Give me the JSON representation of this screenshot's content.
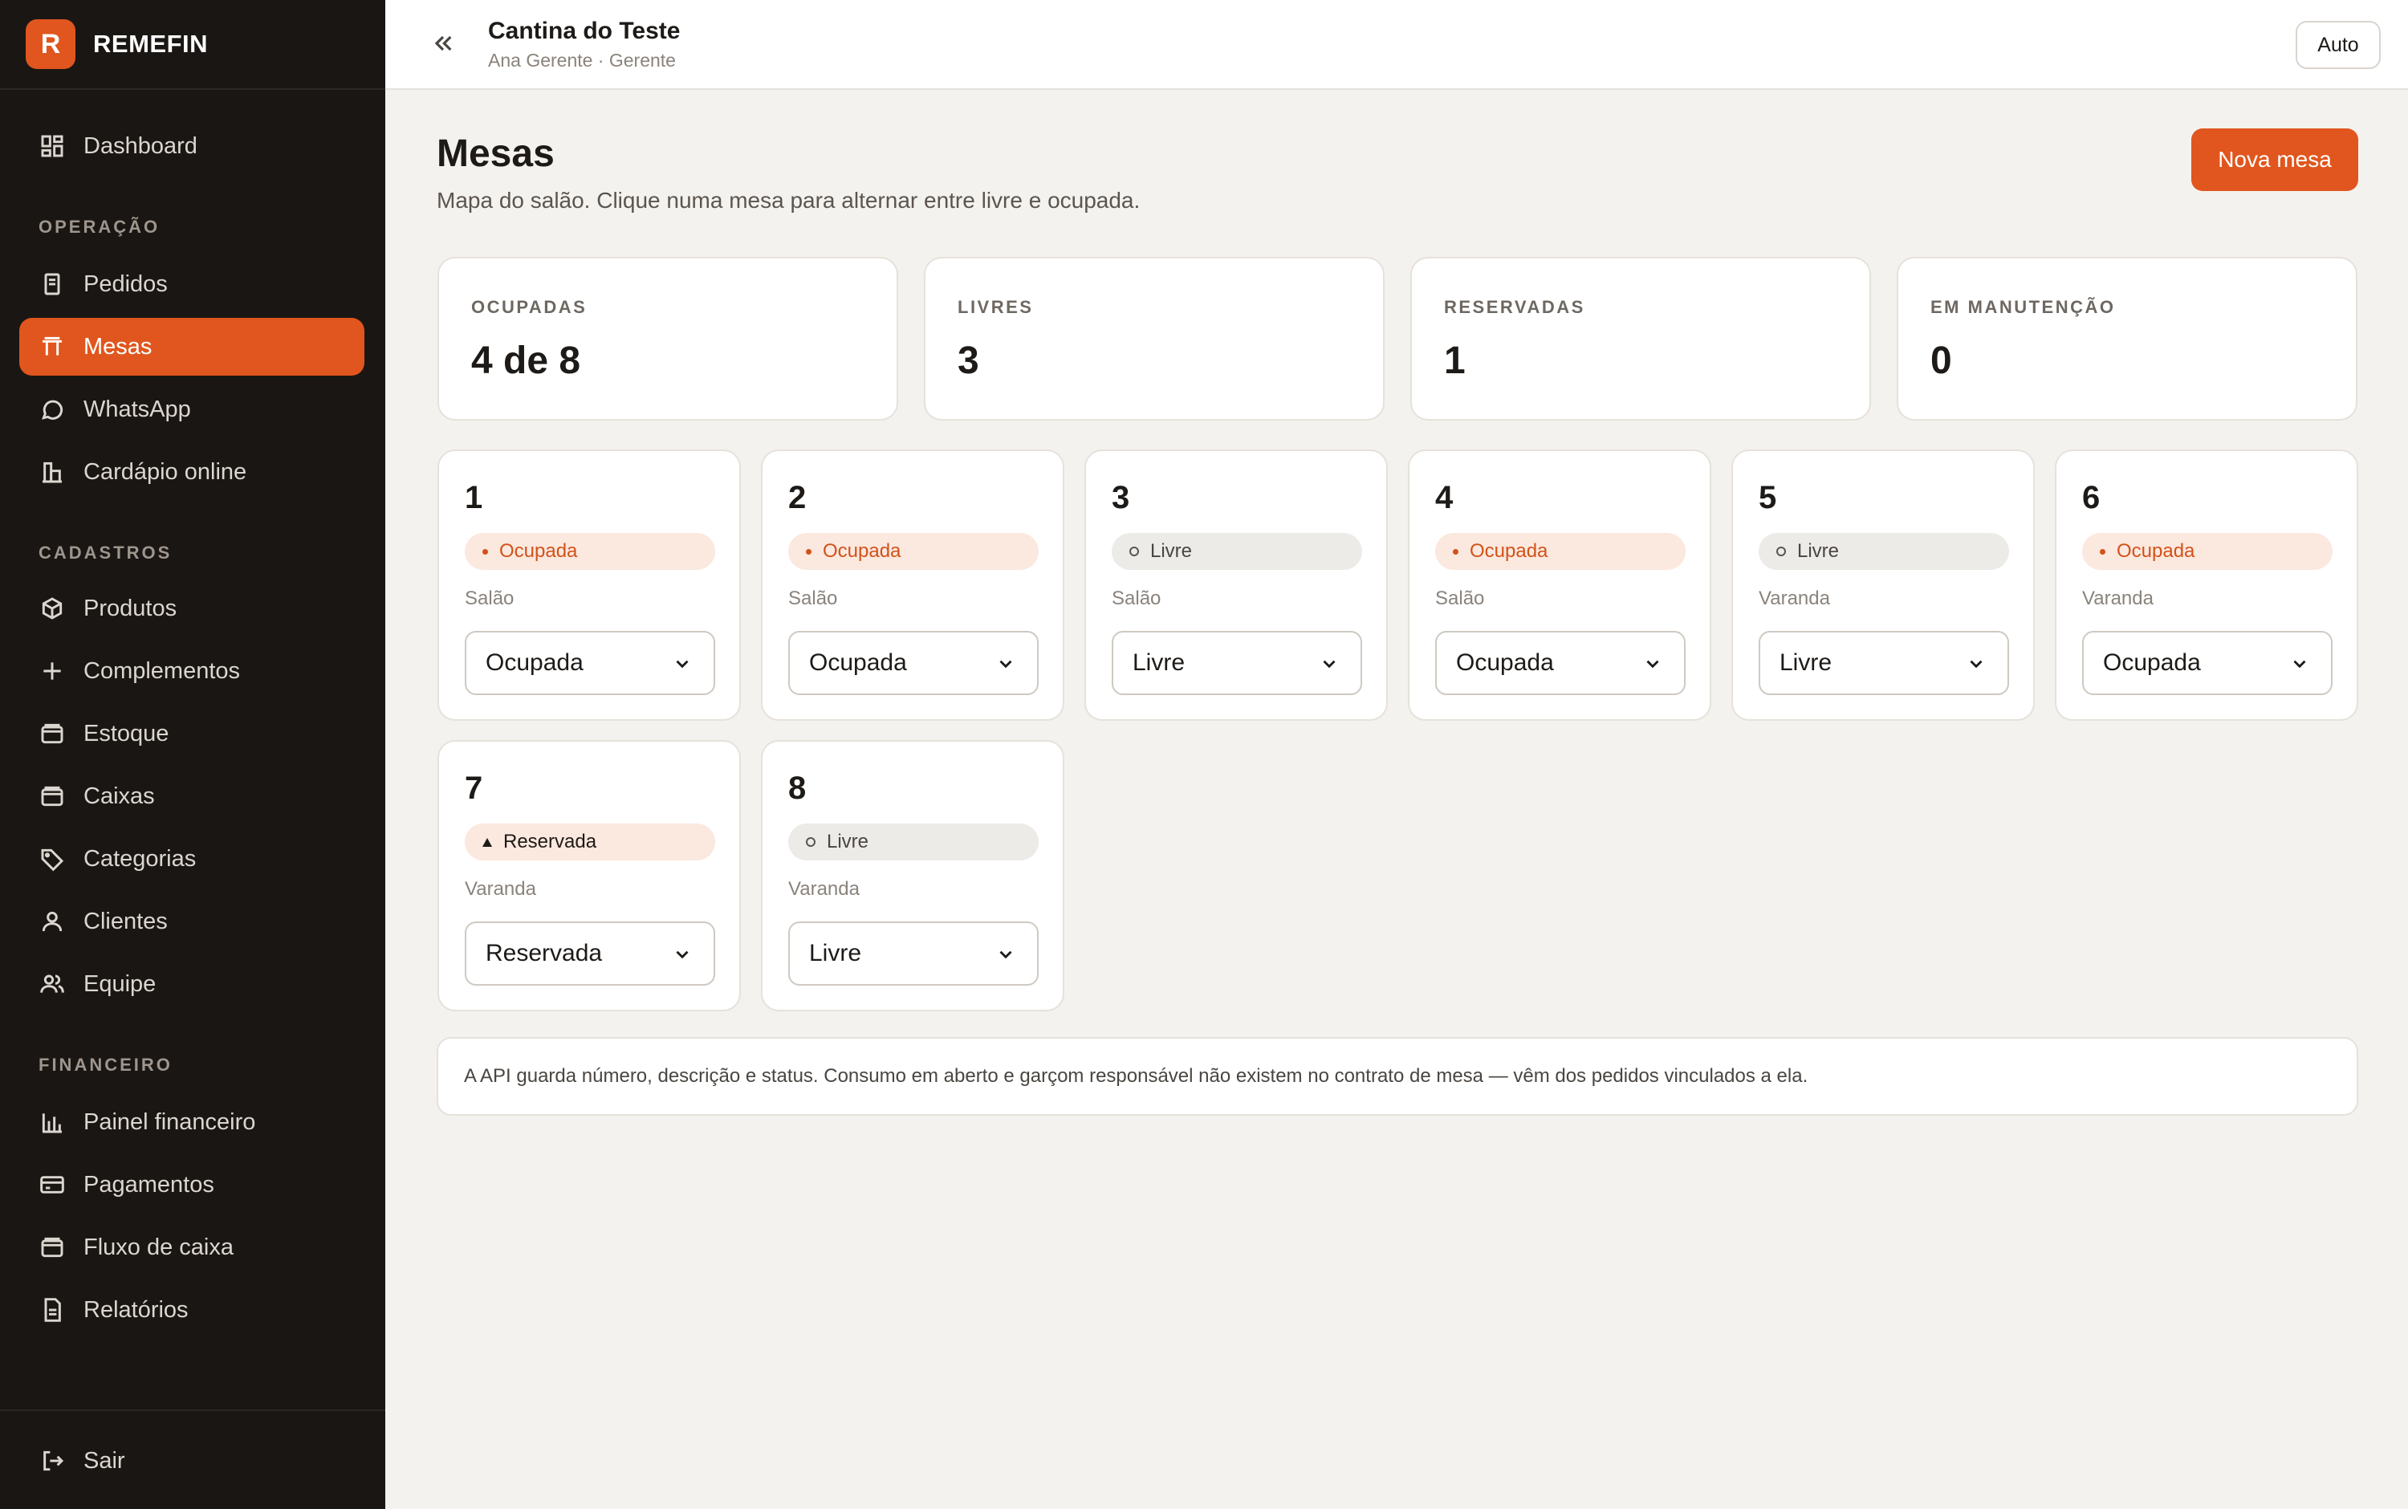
{
  "brand": {
    "logo_letter": "R",
    "name": "REMEFIN",
    "accent": "#e0561e"
  },
  "sidebar": {
    "dashboard": "Dashboard",
    "sections": [
      "OPERAÇÃO",
      "CADASTROS",
      "FINANCEIRO"
    ],
    "operacao": [
      "Pedidos",
      "Mesas",
      "WhatsApp",
      "Cardápio online"
    ],
    "cadastros": [
      "Produtos",
      "Complementos",
      "Estoque",
      "Caixas",
      "Categorias",
      "Clientes",
      "Equipe"
    ],
    "financeiro": [
      "Painel financeiro",
      "Pagamentos",
      "Fluxo de caixa",
      "Relatórios"
    ],
    "logout": "Sair",
    "active_item": "Mesas"
  },
  "topbar": {
    "title": "Cantina do Teste",
    "subtitle": "Ana Gerente · Gerente",
    "theme_button": "Auto"
  },
  "page": {
    "title": "Mesas",
    "description": "Mapa do salão. Clique numa mesa para alternar entre livre e ocupada.",
    "new_button": "Nova mesa"
  },
  "stats": [
    {
      "label": "OCUPADAS",
      "value": "4 de 8"
    },
    {
      "label": "LIVRES",
      "value": "3"
    },
    {
      "label": "RESERVADAS",
      "value": "1"
    },
    {
      "label": "EM MANUTENÇÃO",
      "value": "0"
    }
  ],
  "tables": [
    {
      "number": "1",
      "status": "Ocupada",
      "area": "Salão",
      "select": "Ocupada"
    },
    {
      "number": "2",
      "status": "Ocupada",
      "area": "Salão",
      "select": "Ocupada"
    },
    {
      "number": "3",
      "status": "Livre",
      "area": "Salão",
      "select": "Livre"
    },
    {
      "number": "4",
      "status": "Ocupada",
      "area": "Salão",
      "select": "Ocupada"
    },
    {
      "number": "5",
      "status": "Livre",
      "area": "Varanda",
      "select": "Livre"
    },
    {
      "number": "6",
      "status": "Ocupada",
      "area": "Varanda",
      "select": "Ocupada"
    },
    {
      "number": "7",
      "status": "Reservada",
      "area": "Varanda",
      "select": "Reservada"
    },
    {
      "number": "8",
      "status": "Livre",
      "area": "Varanda",
      "select": "Livre"
    }
  ],
  "note": "A API guarda número, descrição e status. Consumo em aberto e garçom responsável não existem no contrato de mesa — vêm dos pedidos vinculados a ela.",
  "icons": {
    "dashboard": "grid-icon",
    "pedidos": "receipt-icon",
    "mesas": "table-icon",
    "whatsapp": "chat-icon",
    "cardapio": "store-icon",
    "produtos": "box-icon",
    "complementos": "plus-icon",
    "estoque": "box-icon",
    "caixas": "wallet-icon",
    "categorias": "tag-icon",
    "clientes": "user-icon",
    "equipe": "users-icon",
    "painel": "bar-chart-icon",
    "pagamentos": "card-icon",
    "fluxo": "wallet-icon",
    "relatorios": "document-icon",
    "sair": "logout-icon"
  }
}
